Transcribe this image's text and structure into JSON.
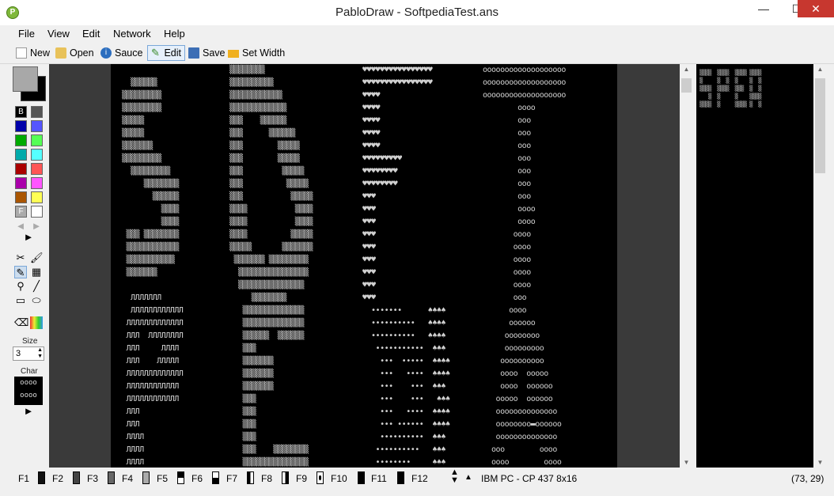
{
  "window": {
    "title": "PabloDraw - SoftpediaTest.ans",
    "minimize": "—",
    "maximize": "☐",
    "close": "✕"
  },
  "menu": [
    "File",
    "View",
    "Edit",
    "Network",
    "Help"
  ],
  "toolbar": {
    "new": "New",
    "open": "Open",
    "sauce": "Sauce",
    "edit": "Edit",
    "save": "Save",
    "set_width": "Set Width"
  },
  "palette": {
    "labels": {
      "b": "B",
      "f": "F"
    },
    "colors": [
      "#000000",
      "#555555",
      "#0000aa",
      "#5555ff",
      "#00aa00",
      "#55ff55",
      "#00aaaa",
      "#55ffff",
      "#aa0000",
      "#ff5555",
      "#aa00aa",
      "#ff55ff",
      "#aa5500",
      "#ffff55",
      "#aaaaaa",
      "#ffffff"
    ],
    "fg": "#a8a8a8",
    "bg": "#000000"
  },
  "left": {
    "size_label": "Size",
    "size_value": "3",
    "char_label": "Char"
  },
  "status": {
    "fkeys": [
      "F1",
      "F2",
      "F3",
      "F4",
      "F5",
      "F6",
      "F7",
      "F8",
      "F9",
      "F10",
      "F11",
      "F12"
    ],
    "font": "IBM PC - CP 437 8x16",
    "cursor": "(73, 29)"
  },
  "art": {
    "col1": [
      "",
      "  ▒▒▒▒▒▒",
      "▒▒▒▒▒▒▒▒▒",
      "▒▒▒▒▒▒▒▒▒",
      "▒▒▒▒▒",
      "▒▒▒▒▒",
      "▒▒▒▒▒▒▒",
      "▒▒▒▒▒▒▒▒▒",
      "  ▒▒▒▒▒▒▒▒▒",
      "     ▒▒▒▒▒▒▒▒",
      "       ▒▒▒▒▒▒",
      "         ▒▒▒▒",
      "         ▒▒▒▒",
      " ▒▒▒ ▒▒▒▒▒▒▒▒",
      " ▒▒▒▒▒▒▒▒▒▒▒▒",
      " ▒▒▒▒▒▒▒▒▒▒▒",
      " ▒▒▒▒▒▒▒",
      "",
      "  ЛЛЛЛЛЛЛ",
      "  ЛЛЛЛЛЛЛЛЛЛЛЛ",
      " ЛЛЛЛЛЛЛЛЛЛЛЛЛ",
      " ЛЛЛ  ЛЛЛЛЛЛЛЛ",
      " ЛЛЛ     ЛЛЛЛ",
      " ЛЛЛ    ЛЛЛЛЛ",
      " ЛЛЛЛЛЛЛЛЛЛЛЛЛ",
      " ЛЛЛЛЛЛЛЛЛЛЛЛ",
      " ЛЛЛЛЛЛЛЛЛЛЛЛ",
      " ЛЛЛ",
      " ЛЛЛ",
      " ЛЛЛЛ",
      " ЛЛЛЛ",
      " ЛЛЛЛ"
    ],
    "col2": [
      "▒▒▒▒▒▒▒▒",
      "▒▒▒▒▒▒▒▒▒▒",
      "▒▒▒▒▒▒▒▒▒▒▒▒",
      "▒▒▒▒▒▒▒▒▒▒▒▒▒",
      "▒▒▒    ▒▒▒▒▒▒",
      "▒▒▒      ▒▒▒▒▒▒",
      "▒▒▒        ▒▒▒▒▒",
      "▒▒▒        ▒▒▒▒▒",
      "▒▒▒         ▒▒▒▒▒",
      "▒▒▒          ▒▒▒▒▒",
      "▒▒▒           ▒▒▒▒▒",
      "▒▒▒▒           ▒▒▒▒",
      "▒▒▒▒           ▒▒▒▒",
      "▒▒▒▒          ▒▒▒▒▒",
      "▒▒▒▒▒       ▒▒▒▒▒▒▒",
      " ▒▒▒▒▒▒▒ ▒▒▒▒▒▒▒▒▒",
      "  ▒▒▒▒▒▒▒▒▒▒▒▒▒▒▒▒",
      "  ▒▒▒▒▒▒▒▒▒▒▒▒▒▒▒",
      "     ▒▒▒▒▒▒▒▒",
      "   ▒▒▒▒▒▒▒▒▒▒▒▒▒▒",
      "   ▒▒▒▒▒▒▒▒▒▒▒▒▒▒",
      "   ▒▒▒▒▒▒  ▒▒▒▒▒▒",
      "   ▒▒▒",
      "   ▒▒▒▒▒▒▒",
      "   ▒▒▒▒▒▒▒",
      "   ▒▒▒▒▒▒▒",
      "   ▒▒▒",
      "   ▒▒▒",
      "   ▒▒▒",
      "   ▒▒▒",
      "   ▒▒▒    ▒▒▒▒▒▒▒▒",
      "   ▒▒▒▒▒▒▒▒▒▒▒▒▒▒▒"
    ],
    "col3": [
      "♥♥♥♥♥♥♥♥♥♥♥♥♥♥♥♥",
      "♥♥♥♥♥♥♥♥♥♥♥♥♥♥♥♥",
      "♥♥♥♥",
      "♥♥♥♥",
      "♥♥♥♥",
      "♥♥♥♥",
      "♥♥♥♥",
      "♥♥♥♥♥♥♥♥♥",
      "♥♥♥♥♥♥♥♥",
      "♥♥♥♥♥♥♥♥",
      "♥♥♥",
      "♥♥♥",
      "♥♥♥",
      "♥♥♥",
      "♥♥♥",
      "♥♥♥",
      "♥♥♥",
      "♥♥♥",
      "♥♥♥",
      "  •••••••      ♠♠♠♠",
      "  ••••••••••   ♠♠♠♠",
      "  ••••••••••   ♠♠♠♠",
      "   •••••••••••  ♠♠♠",
      "    •••  •••••  ♠♠♠♠",
      "    •••   ••••  ♠♠♠♠",
      "    •••    •••  ♠♠♠",
      "    •••    •••   ♠♠♠",
      "    •••   ••••  ♠♠♠♠",
      "    ••• ••••••  ♠♠♠♠",
      "    ••••••••••  ♠♠♠",
      "   ••••••••••   ♠♠♠",
      "   ••••••••     ♠♠♠"
    ],
    "col4": [
      "ooooooooooooooooooo",
      "ooooooooooooooooooo",
      "ooooooooooooooooooo",
      "        oooo",
      "        ooo",
      "        ooo",
      "        ooo",
      "        ooo",
      "        ooo",
      "        ooo",
      "        ooo",
      "        oooo",
      "        oooo",
      "       oooo",
      "       oooo",
      "       oooo",
      "       oooo",
      "       oooo",
      "       ooo",
      "      oooo",
      "      oooooo",
      "     oooooooo",
      "     ooooooooo",
      "    oooooooooo",
      "    oooo  ooooo",
      "    oooo  oooooo",
      "   ooooo  oooooo",
      "   oooooooooooooo",
      "   oooooooo▬oooooo",
      "   oooooooooooooo",
      "  ooo        oooo",
      "  oooo        oooo"
    ],
    "preview": [
      "▒▒▒▒  ▒▒▒▒  ▒▒▒▒ ▒▒▒▒",
      "▒     ▒  ▒  ▒    ▒  ▒",
      "▒▒▒▒  ▒▒▒▒  ▒▒▒  ▒  ▒",
      "   ▒  ▒     ▒    ▒▒▒▒",
      "▒▒▒▒  ▒     ▒▒▒▒ ▒  ▒"
    ]
  }
}
